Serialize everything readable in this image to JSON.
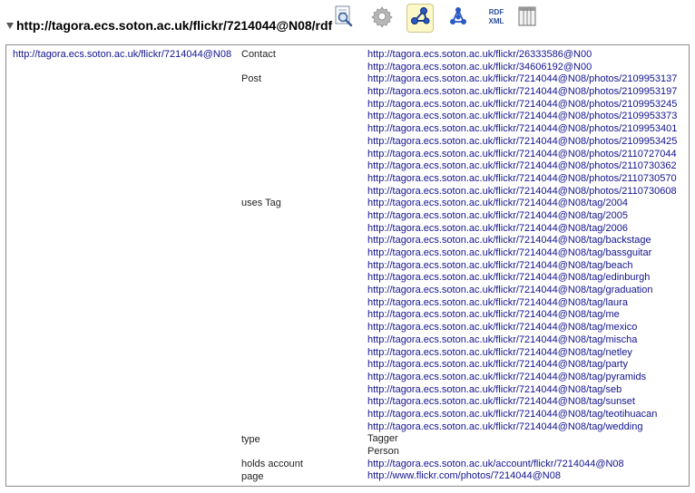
{
  "header": {
    "title": "http://tagora.ecs.soton.ac.uk/flickr/7214044@N08/rdf",
    "toolbar": [
      {
        "icon": "inspect-page-icon"
      },
      {
        "icon": "gear-icon"
      },
      {
        "icon": "graph-view-icon",
        "active": true
      },
      {
        "icon": "network-icon"
      },
      {
        "icon": "rdf-xml-icon",
        "text_top": "RDF",
        "text_bottom": "XML"
      },
      {
        "icon": "table-view-icon"
      }
    ]
  },
  "subject": "http://tagora.ecs.soton.ac.uk/flickr/7214044@N08",
  "properties": [
    {
      "label": "Contact",
      "values": [
        "http://tagora.ecs.soton.ac.uk/flickr/26333586@N00",
        "http://tagora.ecs.soton.ac.uk/flickr/34606192@N00"
      ]
    },
    {
      "label": "Post",
      "values": [
        "http://tagora.ecs.soton.ac.uk/flickr/7214044@N08/photos/2109953137",
        "http://tagora.ecs.soton.ac.uk/flickr/7214044@N08/photos/2109953197",
        "http://tagora.ecs.soton.ac.uk/flickr/7214044@N08/photos/2109953245",
        "http://tagora.ecs.soton.ac.uk/flickr/7214044@N08/photos/2109953373",
        "http://tagora.ecs.soton.ac.uk/flickr/7214044@N08/photos/2109953401",
        "http://tagora.ecs.soton.ac.uk/flickr/7214044@N08/photos/2109953425",
        "http://tagora.ecs.soton.ac.uk/flickr/7214044@N08/photos/2110727044",
        "http://tagora.ecs.soton.ac.uk/flickr/7214044@N08/photos/2110730362",
        "http://tagora.ecs.soton.ac.uk/flickr/7214044@N08/photos/2110730570",
        "http://tagora.ecs.soton.ac.uk/flickr/7214044@N08/photos/2110730608"
      ]
    },
    {
      "label": "uses Tag",
      "values": [
        "http://tagora.ecs.soton.ac.uk/flickr/7214044@N08/tag/2004",
        "http://tagora.ecs.soton.ac.uk/flickr/7214044@N08/tag/2005",
        "http://tagora.ecs.soton.ac.uk/flickr/7214044@N08/tag/2006",
        "http://tagora.ecs.soton.ac.uk/flickr/7214044@N08/tag/backstage",
        "http://tagora.ecs.soton.ac.uk/flickr/7214044@N08/tag/bassguitar",
        "http://tagora.ecs.soton.ac.uk/flickr/7214044@N08/tag/beach",
        "http://tagora.ecs.soton.ac.uk/flickr/7214044@N08/tag/edinburgh",
        "http://tagora.ecs.soton.ac.uk/flickr/7214044@N08/tag/graduation",
        "http://tagora.ecs.soton.ac.uk/flickr/7214044@N08/tag/laura",
        "http://tagora.ecs.soton.ac.uk/flickr/7214044@N08/tag/me",
        "http://tagora.ecs.soton.ac.uk/flickr/7214044@N08/tag/mexico",
        "http://tagora.ecs.soton.ac.uk/flickr/7214044@N08/tag/mischa",
        "http://tagora.ecs.soton.ac.uk/flickr/7214044@N08/tag/netley",
        "http://tagora.ecs.soton.ac.uk/flickr/7214044@N08/tag/party",
        "http://tagora.ecs.soton.ac.uk/flickr/7214044@N08/tag/pyramids",
        "http://tagora.ecs.soton.ac.uk/flickr/7214044@N08/tag/seb",
        "http://tagora.ecs.soton.ac.uk/flickr/7214044@N08/tag/sunset",
        "http://tagora.ecs.soton.ac.uk/flickr/7214044@N08/tag/teotihuacan",
        "http://tagora.ecs.soton.ac.uk/flickr/7214044@N08/tag/wedding"
      ]
    },
    {
      "label": "type",
      "literal": true,
      "values": [
        "Tagger",
        "Person"
      ]
    },
    {
      "label": "holds account",
      "values": [
        "http://tagora.ecs.soton.ac.uk/account/flickr/7214044@N08"
      ]
    },
    {
      "label": "page",
      "values": [
        "http://www.flickr.com/photos/7214044@N08"
      ]
    }
  ],
  "colors": {
    "link": "#13138f",
    "text": "#222222",
    "active_tool_bg": "#fdf8c8",
    "panel_border": "#8a8a8a"
  }
}
